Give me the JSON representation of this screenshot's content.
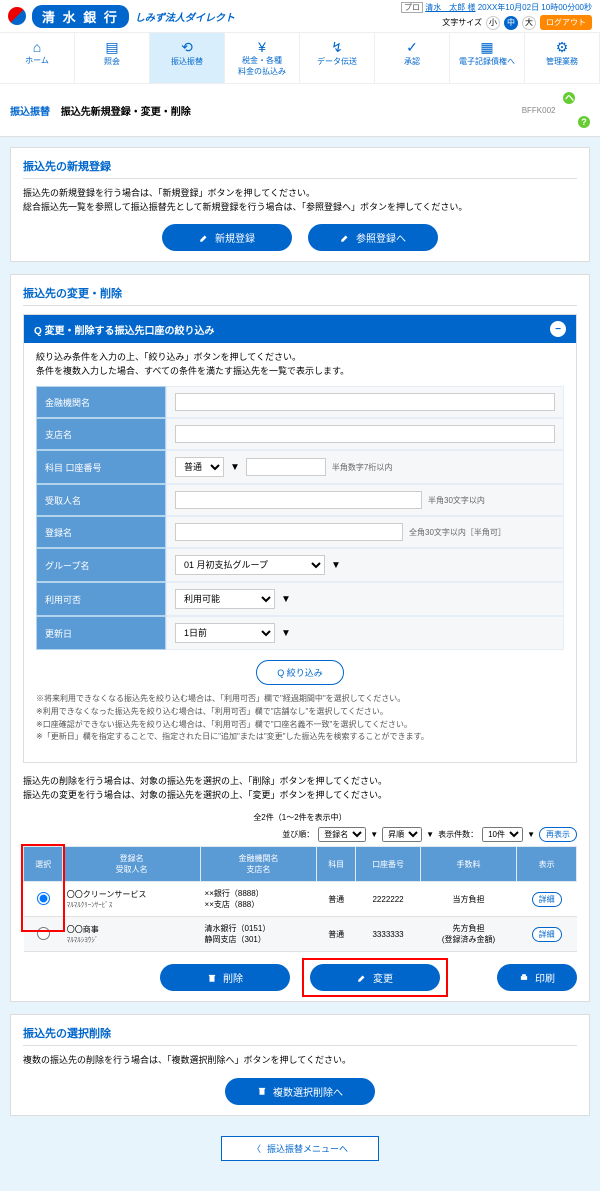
{
  "header": {
    "bank_name": "清 水 銀 行",
    "sub_logo": "しみず法人ダイレクト",
    "user_badge": "プロ",
    "user_link": "清水　太郎 様",
    "datetime": "20XX年10月02日 10時00分00秒",
    "font_label": "文字サイズ",
    "font_small": "小",
    "font_mid": "中",
    "font_large": "大",
    "logout": "ログアウト"
  },
  "nav": [
    {
      "label": "ホーム"
    },
    {
      "label": "照会"
    },
    {
      "label": "振込振替"
    },
    {
      "label": "税金・各種\n料金の払込み"
    },
    {
      "label": "データ伝送"
    },
    {
      "label": "承認"
    },
    {
      "label": "電子記録債権へ"
    },
    {
      "label": "管理業務"
    }
  ],
  "breadcrumb": {
    "category": "振込振替",
    "title": "振込先新規登録・変更・削除",
    "page_id": "BFFK002",
    "help": "ヘルプ"
  },
  "block_new": {
    "title": "振込先の新規登録",
    "text": "振込先の新規登録を行う場合は、「新規登録」ボタンを押してください。\n総合振込先一覧を参照して振込振替先として新規登録を行う場合は、「参照登録へ」ボタンを押してください。",
    "btn_new": "新規登録",
    "btn_ref": "参照登録へ"
  },
  "block_edit": {
    "title": "振込先の変更・削除",
    "accordion": "変更・削除する振込先口座の絞り込み",
    "accordion_icon": "Q",
    "filter_text": "絞り込み条件を入力の上、「絞り込み」ボタンを押してください。\n条件を複数入力した場合、すべての条件を満たす振込先を一覧で表示します。",
    "rows": {
      "bank": "金融機関名",
      "branch": "支店名",
      "account": "科目 口座番号",
      "acct_type": "普通",
      "acct_hint": "半角数字7桁以内",
      "payee": "受取人名",
      "payee_hint": "半角30文字以内",
      "reg_name": "登録名",
      "reg_hint": "全角30文字以内［半角可］",
      "group": "グループ名",
      "group_val": "01 月初支払グループ",
      "usable": "利用可否",
      "usable_val": "利用可能",
      "update": "更新日",
      "update_val": "1日前"
    },
    "btn_filter": "絞り込み",
    "notes": "※将来利用できなくなる振込先を絞り込む場合は、「利用可否」欄で\"経過期間中\"を選択してください。\n※利用できなくなった振込先を絞り込む場合は、「利用可否」欄で\"店舗なし\"を選択してください。\n※口座確認ができない振込先を絞り込む場合は、「利用可否」欄で\"口座名義不一致\"を選択してください。\n※「更新日」欄を指定することで、指定された日に\"追加\"または\"変更\"した振込先を検索することができます。",
    "instruction": "振込先の削除を行う場合は、対象の振込先を選択の上、「削除」ボタンを押してください。\n振込先の変更を行う場合は、対象の振込先を選択の上、「変更」ボタンを押してください。",
    "count": "全2件（1～2件を表示中）",
    "sort": {
      "label1": "並び順：",
      "val1": "登録名",
      "val2": "昇順",
      "label2": "表示件数：",
      "val3": "10件",
      "redisplay": "再表示"
    },
    "headers": [
      "選択",
      "登録名\n受取人名",
      "金融機関名\n支店名",
      "科目",
      "口座番号",
      "手数料",
      "表示"
    ],
    "rows_data": [
      {
        "selected": true,
        "name": "〇〇クリーンサービス",
        "kana": "ﾏﾙﾏﾙｸﾘｰﾝｻｰﾋﾞｽ",
        "bank": "××銀行（8888）",
        "branch": "××支店（888）",
        "type": "普通",
        "number": "2222222",
        "fee": "当方負担",
        "detail": "詳細"
      },
      {
        "selected": false,
        "name": "〇〇商事",
        "kana": "ﾏﾙﾏﾙｼﾖｳｼﾞ",
        "bank": "清水銀行（0151）",
        "branch": "静岡支店（301）",
        "type": "普通",
        "number": "3333333",
        "fee": "先方負担\n(登録済み金額)",
        "detail": "詳細"
      }
    ],
    "btn_delete": "削除",
    "btn_change": "変更",
    "btn_print": "印刷"
  },
  "block_bulk": {
    "title": "振込先の選択削除",
    "text": "複数の振込先の削除を行う場合は、「複数選択削除へ」ボタンを押してください。",
    "btn": "複数選択削除へ"
  },
  "back": "振込振替メニューへ"
}
